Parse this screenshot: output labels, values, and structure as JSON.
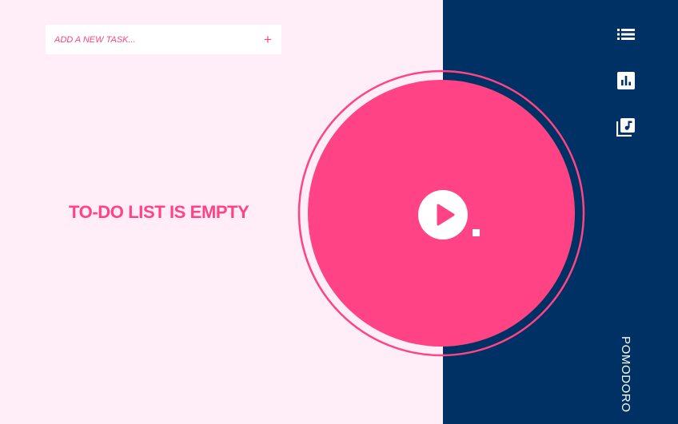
{
  "task_input": {
    "placeholder": "ADD A NEW TASK...",
    "value": ""
  },
  "add_button": {
    "label": "+"
  },
  "todo": {
    "empty_message": "TO-DO LIST IS EMPTY"
  },
  "timer": {
    "play_icon": "play-icon",
    "state": "stopped"
  },
  "nav": {
    "items": [
      {
        "icon": "list-icon"
      },
      {
        "icon": "bar-chart-icon"
      },
      {
        "icon": "music-library-icon"
      }
    ]
  },
  "brand": {
    "label": "POMODORO"
  },
  "colors": {
    "background_left": "#FFEDF7",
    "background_right": "#003164",
    "accent": "#FF4384",
    "white": "#FFFFFF"
  }
}
